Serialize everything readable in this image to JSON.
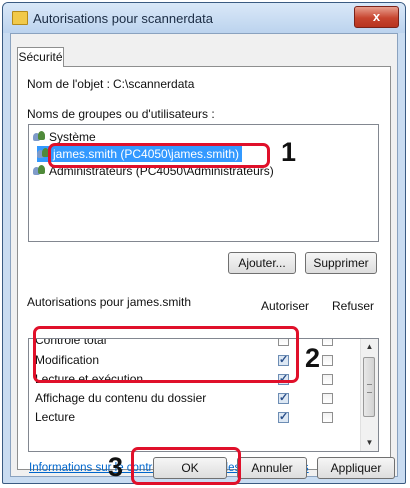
{
  "window": {
    "title": "Autorisations pour scannerdata",
    "close_label": "x"
  },
  "tab": {
    "label": "Sécurité"
  },
  "object": {
    "label": "Nom de l'objet :",
    "value": "C:\\scannerdata"
  },
  "groups": {
    "label": "Noms de groupes ou d'utilisateurs :",
    "items": [
      {
        "label": "Système",
        "selected": false
      },
      {
        "label": "james.smith (PC4050\\james.smith)",
        "selected": true
      },
      {
        "label": "Administrateurs (PC4050\\Administrateurs)",
        "selected": false
      }
    ]
  },
  "buttons": {
    "add": "Ajouter...",
    "remove": "Supprimer",
    "ok": "OK",
    "cancel": "Annuler",
    "apply": "Appliquer"
  },
  "permissions": {
    "title": "Autorisations pour james.smith",
    "allow_header": "Autoriser",
    "deny_header": "Refuser",
    "rows": [
      {
        "name": "Contrôle total",
        "allow": false,
        "deny": false
      },
      {
        "name": "Modification",
        "allow": true,
        "deny": false
      },
      {
        "name": "Lecture et exécution",
        "allow": true,
        "deny": false
      },
      {
        "name": "Affichage du contenu du dossier",
        "allow": true,
        "deny": false
      },
      {
        "name": "Lecture",
        "allow": true,
        "deny": false
      }
    ]
  },
  "link": "Informations sur le contrôle d'accès et les autorisations",
  "callouts": [
    "1",
    "2",
    "3"
  ],
  "colors": {
    "highlight": "#e0102a",
    "selection": "#3399ff",
    "link": "#0066cc"
  }
}
